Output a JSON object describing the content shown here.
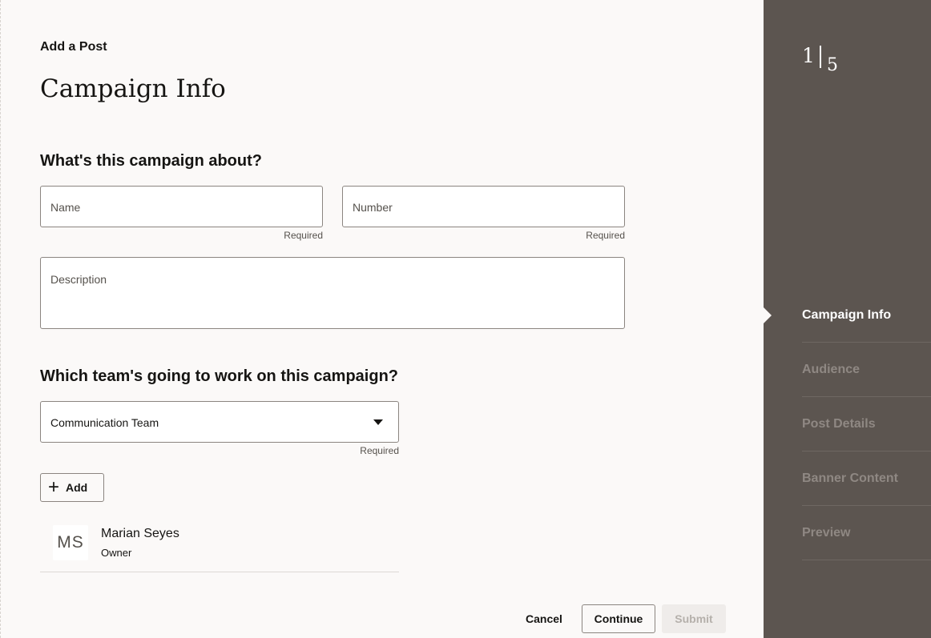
{
  "header": {
    "eyebrow": "Add a Post",
    "title": "Campaign Info"
  },
  "about_section": {
    "heading": "What's this campaign about?",
    "name_field": {
      "label": "Name",
      "helper": "Required",
      "value": ""
    },
    "number_field": {
      "label": "Number",
      "helper": "Required",
      "value": ""
    },
    "description_field": {
      "label": "Description",
      "value": ""
    }
  },
  "team_section": {
    "heading": "Which team's going to work on this campaign?",
    "team_select": {
      "value": "Communication Team",
      "helper": "Required"
    },
    "add_label": "Add",
    "members": [
      {
        "initials": "MS",
        "name": "Marian Seyes",
        "role": "Owner"
      }
    ]
  },
  "footer": {
    "cancel_label": "Cancel",
    "continue_label": "Continue",
    "submit_label": "Submit"
  },
  "sidebar": {
    "current_step": "1",
    "total_steps": "5",
    "steps": [
      {
        "label": "Campaign Info",
        "active": true
      },
      {
        "label": "Audience",
        "active": false
      },
      {
        "label": "Post Details",
        "active": false
      },
      {
        "label": "Banner Content",
        "active": false
      },
      {
        "label": "Preview",
        "active": false
      }
    ]
  },
  "colors": {
    "sidebar_bg": "#5c5550",
    "page_bg": "#fbf9f8",
    "text": "#161513"
  },
  "icons": {
    "add": "plus-icon",
    "dropdown": "chevron-down-icon"
  }
}
